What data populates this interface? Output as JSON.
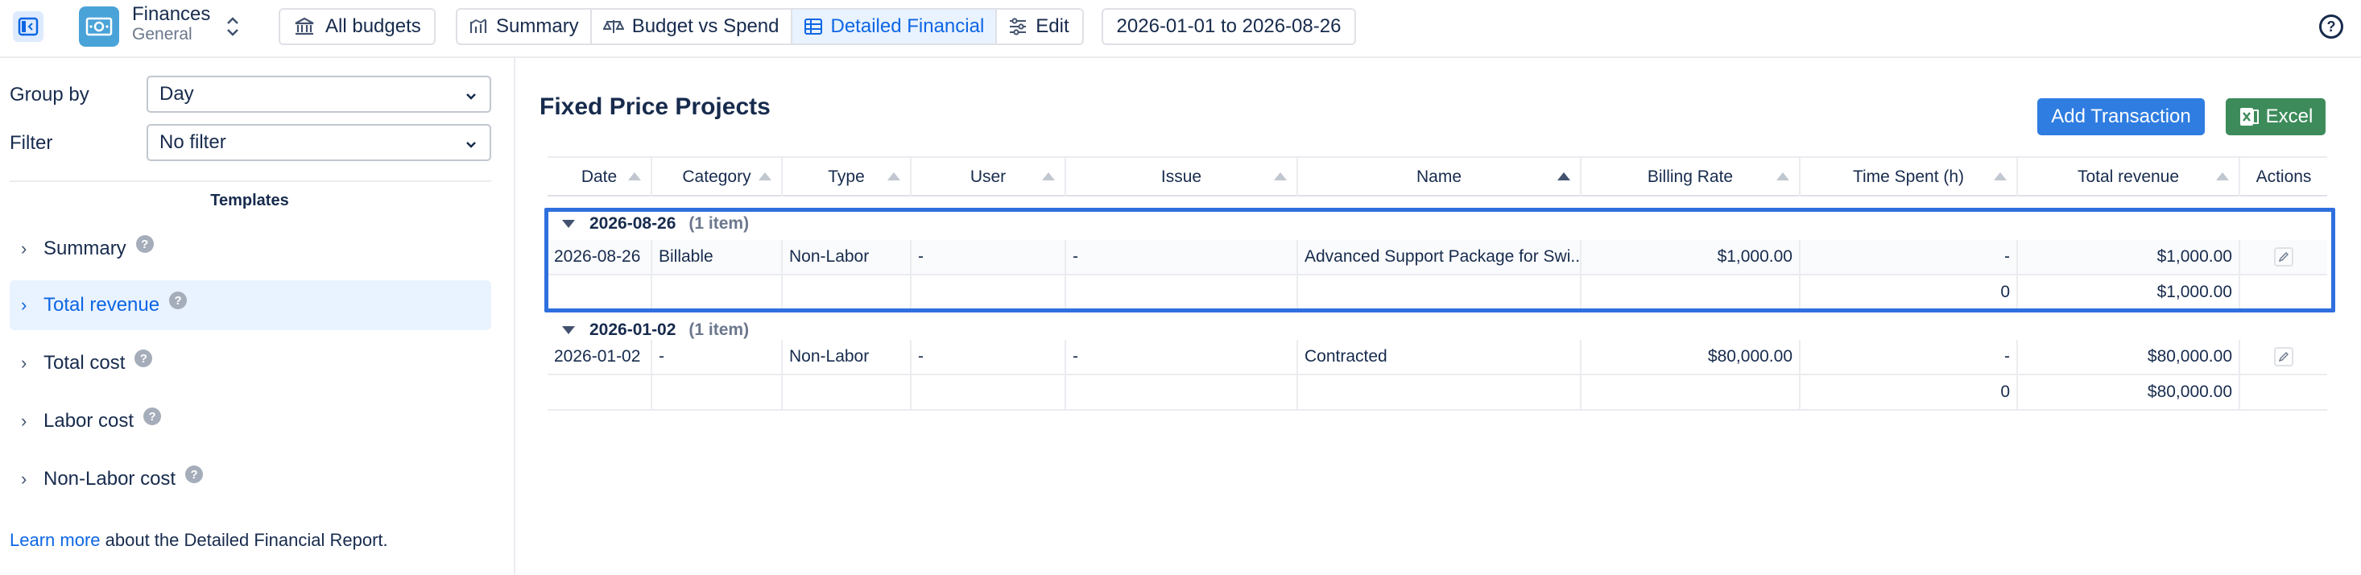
{
  "app": {
    "title": "Finances",
    "subtitle": "General"
  },
  "toolbar": {
    "all_budgets": "All budgets",
    "tabs": [
      {
        "label": "Summary",
        "icon": "summary-chart-icon"
      },
      {
        "label": "Budget vs Spend",
        "icon": "scale-icon"
      },
      {
        "label": "Detailed Financial",
        "icon": "table-icon",
        "active": true
      },
      {
        "label": "Edit",
        "icon": "sliders-icon"
      }
    ],
    "date_range": "2026-01-01 to 2026-08-26",
    "help": "?"
  },
  "sidebar": {
    "group_by_label": "Group by",
    "group_by_value": "Day",
    "filter_label": "Filter",
    "filter_value": "No filter",
    "templates_heading": "Templates",
    "templates": [
      {
        "label": "Summary",
        "active": false
      },
      {
        "label": "Total revenue",
        "active": true
      },
      {
        "label": "Total cost",
        "active": false
      },
      {
        "label": "Labor cost",
        "active": false
      },
      {
        "label": "Non-Labor cost",
        "active": false
      }
    ],
    "learn_more_link": "Learn more",
    "learn_more_text": " about the Detailed Financial Report."
  },
  "main": {
    "title": "Fixed Price Projects",
    "add_button": "Add Transaction",
    "excel_button": "Excel",
    "columns": [
      "Date",
      "Category",
      "Type",
      "User",
      "Issue",
      "Name",
      "Billing Rate",
      "Time Spent (h)",
      "Total revenue",
      "Actions"
    ],
    "sorted_column": "Name",
    "groups": [
      {
        "date": "2026-08-26",
        "count": "(1 item)",
        "rows": [
          [
            "2026-08-26",
            "Billable",
            "Non-Labor",
            "-",
            "-",
            "Advanced Support Package for Swi...",
            "$1,000.00",
            "-",
            "$1,000.00"
          ]
        ],
        "totals": {
          "time": "0",
          "revenue": "$1,000.00"
        }
      },
      {
        "date": "2026-01-02",
        "count": "(1 item)",
        "rows": [
          [
            "2026-01-02",
            "-",
            "Non-Labor",
            "-",
            "-",
            "Contracted",
            "$80,000.00",
            "-",
            "$80,000.00"
          ]
        ],
        "totals": {
          "time": "0",
          "revenue": "$80,000.00"
        }
      }
    ]
  },
  "colors": {
    "accent": "#0c66e4",
    "primary_button": "#2f7de1",
    "excel_button": "#3d8b5a",
    "highlight": "#2f6fde"
  }
}
